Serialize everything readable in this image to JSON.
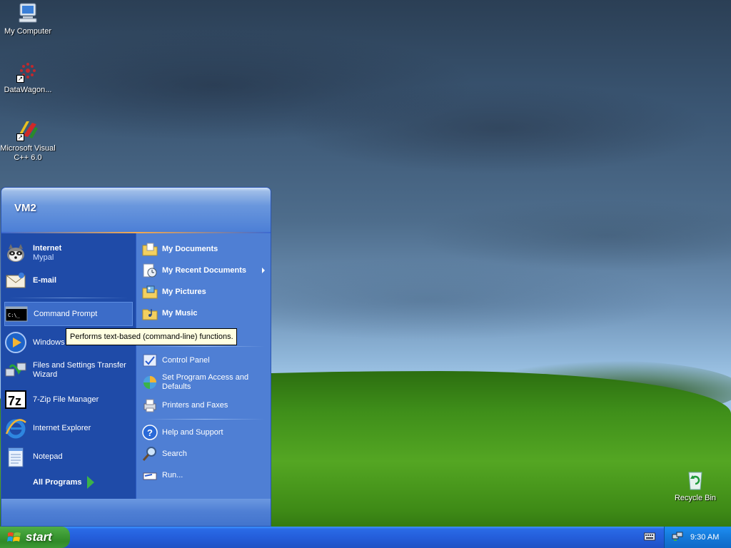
{
  "desktop": {
    "icons": [
      {
        "label": "My Computer",
        "icon": "my-computer-icon"
      },
      {
        "label": "DataWagon...",
        "icon": "datawagon-icon"
      },
      {
        "label": "Microsoft Visual C++ 6.0",
        "icon": "visual-cpp-icon"
      },
      {
        "label": "Recycle Bin",
        "icon": "recycle-bin-icon"
      }
    ]
  },
  "start_menu": {
    "user": "VM2",
    "pinned": [
      {
        "label": "Internet",
        "sub": "Mypal",
        "icon": "raccoon-browser-icon"
      },
      {
        "label": "E-mail",
        "icon": "email-icon"
      }
    ],
    "recent": [
      {
        "label": "Command Prompt",
        "icon": "command-prompt-icon"
      },
      {
        "label": "Windows",
        "icon": "media-player-icon"
      },
      {
        "label": "Files and Settings Transfer Wizard",
        "icon": "transfer-wizard-icon"
      },
      {
        "label": "7-Zip File Manager",
        "icon": "7zip-icon"
      },
      {
        "label": "Internet Explorer",
        "icon": "internet-explorer-icon"
      },
      {
        "label": "Notepad",
        "icon": "notepad-icon"
      }
    ],
    "all_programs": "All Programs",
    "right": [
      {
        "label": "My Documents",
        "icon": "folder-documents-icon"
      },
      {
        "label": "My Recent Documents",
        "icon": "recent-documents-icon"
      },
      {
        "label": "My Pictures",
        "icon": "folder-pictures-icon"
      },
      {
        "label": "My Music",
        "icon": "folder-music-icon"
      },
      {
        "label": "Control Panel",
        "icon": "control-panel-icon"
      },
      {
        "label": "Set Program Access and Defaults",
        "icon": "program-access-icon"
      },
      {
        "label": "Printers and Faxes",
        "icon": "printer-icon"
      },
      {
        "label": "Help and Support",
        "icon": "help-icon"
      },
      {
        "label": "Search",
        "icon": "search-icon"
      },
      {
        "label": "Run...",
        "icon": "run-icon"
      }
    ]
  },
  "tooltip": "Performs text-based (command-line) functions.",
  "taskbar": {
    "start_label": "start",
    "clock": "9:30 AM"
  },
  "colors": {
    "start_green": "#3c9a34",
    "taskbar_blue": "#245edb",
    "menu_left": "#1f4ba8",
    "menu_right": "#4f7fd4",
    "tooltip_bg": "#ffffe1"
  }
}
